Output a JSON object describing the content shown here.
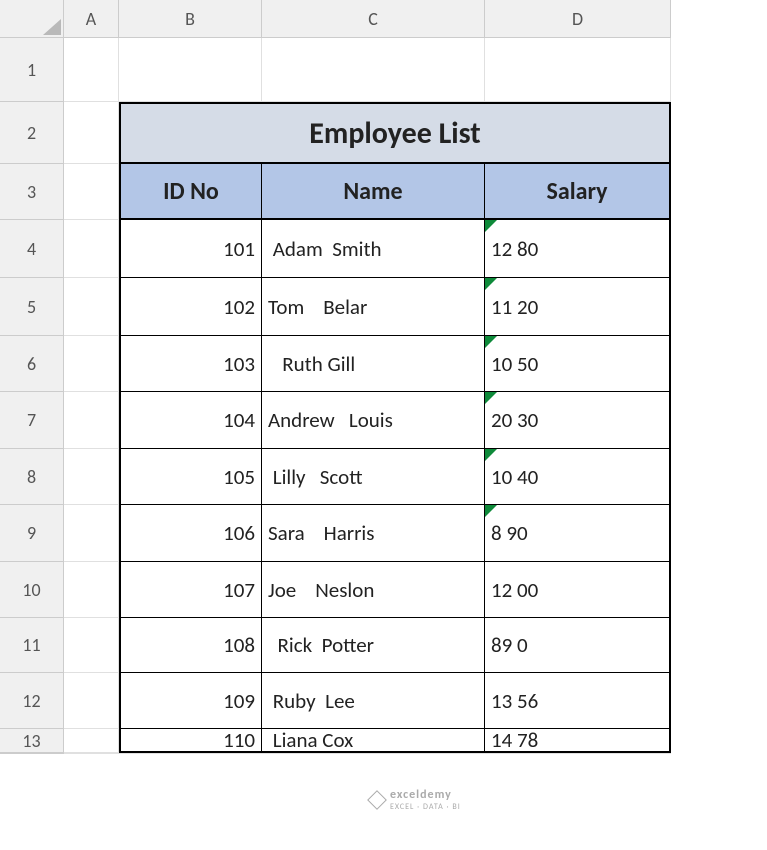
{
  "columns": [
    "A",
    "B",
    "C",
    "D"
  ],
  "rows": [
    "1",
    "2",
    "3",
    "4",
    "5",
    "6",
    "7",
    "8",
    "9",
    "10",
    "11",
    "12",
    "13"
  ],
  "title": "Employee List",
  "headers": {
    "b": "ID No",
    "c": "Name",
    "d": "Salary"
  },
  "data": [
    {
      "id": "101",
      "name": " Adam  Smith",
      "salary": "12 80",
      "err": true
    },
    {
      "id": "102",
      "name": "Tom    Belar",
      "salary": "11 20",
      "err": true
    },
    {
      "id": "103",
      "name": "   Ruth Gill",
      "salary": "10 50",
      "err": true
    },
    {
      "id": "104",
      "name": "Andrew   Louis",
      "salary": "20 30",
      "err": true
    },
    {
      "id": "105",
      "name": " Lilly   Scott",
      "salary": "10 40",
      "err": true
    },
    {
      "id": "106",
      "name": "Sara    Harris",
      "salary": "8 90",
      "err": true
    },
    {
      "id": "107",
      "name": "Joe    Neslon",
      "salary": "12 00",
      "err": false
    },
    {
      "id": "108",
      "name": "  Rick  Potter",
      "salary": "89 0",
      "err": false
    },
    {
      "id": "109",
      "name": " Ruby  Lee",
      "salary": "13 56",
      "err": false
    },
    {
      "id": "110",
      "name": " Liana Cox",
      "salary": "14 78",
      "err": false
    }
  ],
  "watermark": {
    "brand": "exceldemy",
    "tag": "EXCEL · DATA · BI"
  }
}
